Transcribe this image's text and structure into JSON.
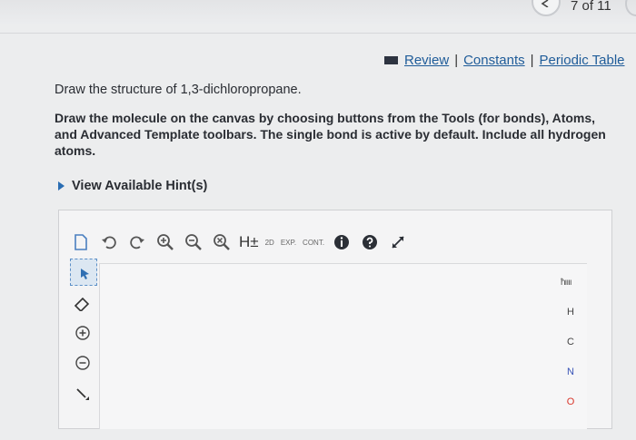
{
  "header": {
    "page_counter": "7 of 11"
  },
  "links": {
    "review": "Review",
    "constants": "Constants",
    "periodic_table": "Periodic Table",
    "separator": "|"
  },
  "question": {
    "prompt": "Draw the structure of 1,3-dichloropropane.",
    "instructions": "Draw the molecule on the canvas by choosing buttons from the Tools (for bonds), Atoms, and Advanced Template toolbars. The single bond is active by default. Include all hydrogen atoms."
  },
  "hint": {
    "label": "View Available Hint(s)"
  },
  "toolbar": {
    "h_label": "H±",
    "d_label": "2D",
    "exp_label": "EXP.",
    "cont_label": "CONT."
  },
  "atoms": {
    "items": [
      "H",
      "C",
      "N",
      "O"
    ]
  },
  "periodic_label": "ħıııı",
  "colors": {
    "link": "#1f5c99",
    "nitrogen": "#3a54b7",
    "oxygen": "#d9362b"
  }
}
